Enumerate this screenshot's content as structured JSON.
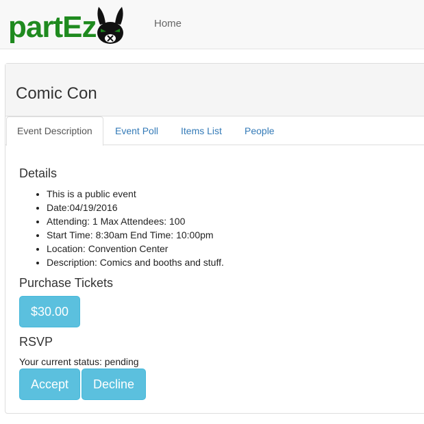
{
  "brand": {
    "name": "partEz"
  },
  "nav": {
    "home": "Home"
  },
  "event": {
    "title": "Comic Con"
  },
  "tabs": [
    {
      "label": "Event Description",
      "active": true
    },
    {
      "label": "Event Poll",
      "active": false
    },
    {
      "label": "Items List",
      "active": false
    },
    {
      "label": "People",
      "active": false
    }
  ],
  "details": {
    "heading": "Details",
    "items": [
      "This is a public event",
      "Date:04/19/2016",
      "Attending: 1 Max Attendees: 100",
      "Start Time: 8:30am End Time: 10:00pm",
      "Location: Convention Center",
      "Description: Comics and booths and stuff."
    ]
  },
  "tickets": {
    "heading": "Purchase Tickets",
    "price_label": "$30.00"
  },
  "rsvp": {
    "heading": "RSVP",
    "status_text": "Your current status: pending",
    "accept_label": "Accept",
    "decline_label": "Decline"
  },
  "colors": {
    "brand": "#1f8a1f",
    "button": "#5bc0de",
    "link": "#337ab7"
  }
}
